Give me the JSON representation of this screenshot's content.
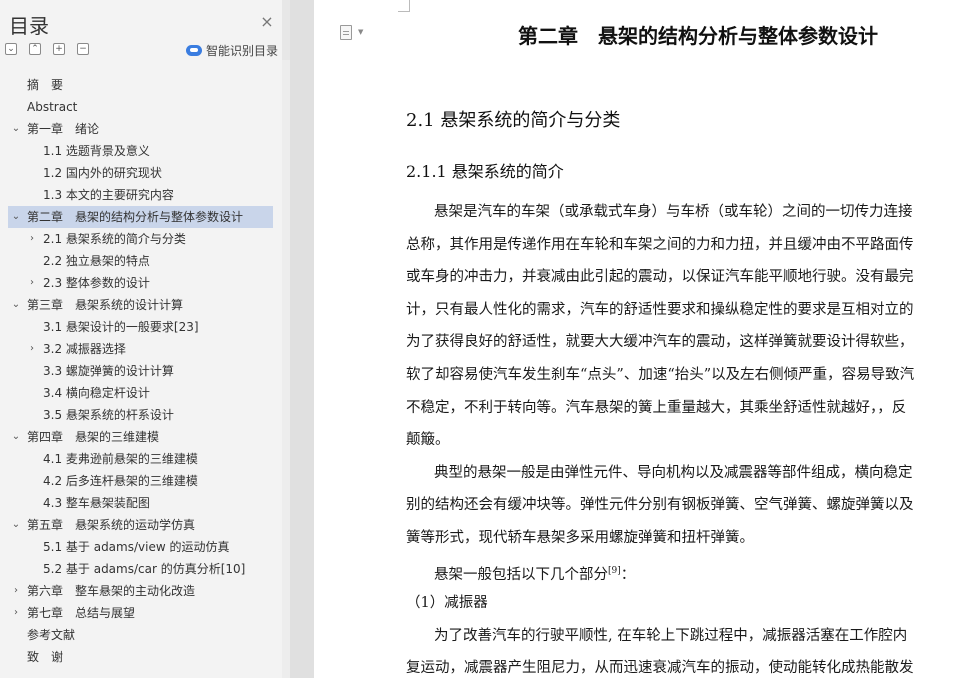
{
  "sidebar": {
    "title": "目录",
    "close_icon": "×",
    "tool_icons": [
      "collapse-icon",
      "expand-icon",
      "add-icon",
      "remove-icon"
    ],
    "tool_glyphs": [
      "⌄",
      "⌃",
      "+",
      "−"
    ],
    "smart_toc_label": "智能识别目录",
    "items": [
      {
        "label": "摘　要",
        "level": 0,
        "arrow": ""
      },
      {
        "label": "Abstract",
        "level": 0,
        "arrow": ""
      },
      {
        "label": "第一章　绪论",
        "level": 0,
        "arrow": "⌄"
      },
      {
        "label": "1.1 选题背景及意义",
        "level": 1,
        "arrow": ""
      },
      {
        "label": "1.2 国内外的研究现状",
        "level": 1,
        "arrow": ""
      },
      {
        "label": "1.3 本文的主要研究内容",
        "level": 1,
        "arrow": ""
      },
      {
        "label": "第二章　悬架的结构分析与整体参数设计",
        "level": 0,
        "arrow": "⌄",
        "selected": true
      },
      {
        "label": "2.1 悬架系统的简介与分类",
        "level": 1,
        "arrow": "›"
      },
      {
        "label": "2.2 独立悬架的特点",
        "level": 1,
        "arrow": ""
      },
      {
        "label": "2.3 整体参数的设计",
        "level": 1,
        "arrow": "›"
      },
      {
        "label": "第三章　悬架系统的设计计算",
        "level": 0,
        "arrow": "⌄"
      },
      {
        "label": "3.1 悬架设计的一般要求[23]",
        "level": 1,
        "arrow": ""
      },
      {
        "label": "3.2 减振器选择",
        "level": 1,
        "arrow": "›"
      },
      {
        "label": "3.3 螺旋弹簧的设计计算",
        "level": 1,
        "arrow": ""
      },
      {
        "label": "3.4 横向稳定杆设计",
        "level": 1,
        "arrow": ""
      },
      {
        "label": "3.5 悬架系统的杆系设计",
        "level": 1,
        "arrow": ""
      },
      {
        "label": "第四章　悬架的三维建模",
        "level": 0,
        "arrow": "⌄"
      },
      {
        "label": "4.1 麦弗逊前悬架的三维建模",
        "level": 1,
        "arrow": ""
      },
      {
        "label": "4.2 后多连杆悬架的三维建模",
        "level": 1,
        "arrow": ""
      },
      {
        "label": "4.3 整车悬架装配图",
        "level": 1,
        "arrow": ""
      },
      {
        "label": "第五章　悬架系统的运动学仿真",
        "level": 0,
        "arrow": "⌄"
      },
      {
        "label": "5.1 基于 adams/view 的运动仿真",
        "level": 1,
        "arrow": ""
      },
      {
        "label": "5.2 基于 adams/car 的仿真分析[10]",
        "level": 1,
        "arrow": ""
      },
      {
        "label": "第六章　整车悬架的主动化改造",
        "level": 0,
        "arrow": "›"
      },
      {
        "label": "第七章　总结与展望",
        "level": 0,
        "arrow": "›"
      },
      {
        "label": "参考文献",
        "level": 0,
        "arrow": ""
      },
      {
        "label": "致　谢",
        "level": 0,
        "arrow": ""
      }
    ]
  },
  "document": {
    "chapter_title": "第二章　悬架的结构分析与整体参数设计",
    "section_title": "2.1 悬架系统的简介与分类",
    "subsection_title": "2.1.1 悬架系统的简介",
    "lines": [
      {
        "text": "悬架是汽车的车架（或承载式车身）与车桥（或车轮）之间的一切传力连接",
        "indent": true
      },
      {
        "text": "总称，其作用是传递作用在车轮和车架之间的力和力扭，并且缓冲由不平路面传",
        "indent": false
      },
      {
        "text": "或车身的冲击力，并衰减由此引起的震动，以保证汽车能平顺地行驶。没有最完",
        "indent": false
      },
      {
        "text": "计，只有最人性化的需求，汽车的舒适性要求和操纵稳定性的要求是互相对立的",
        "indent": false
      },
      {
        "text": "为了获得良好的舒适性，就要大大缓冲汽车的震动，这样弹簧就要设计得软些，",
        "indent": false
      },
      {
        "text": "软了却容易使汽车发生刹车“点头”、加速“抬头”以及左右侧倾严重，容易导致汽",
        "indent": false
      },
      {
        "text": "不稳定，不利于转向等。汽车悬架的簧上重量越大，其乘坐舒适性就越好，，反",
        "indent": false
      },
      {
        "text": "颠簸。",
        "indent": false
      },
      {
        "text": "典型的悬架一般是由弹性元件、导向机构以及减震器等部件组成，横向稳定",
        "indent": true
      },
      {
        "text": "别的结构还会有缓冲块等。弹性元件分别有钢板弹簧、空气弹簧、螺旋弹簧以及",
        "indent": false
      },
      {
        "text": "簧等形式，现代轿车悬架多采用螺旋弹簧和扭杆弹簧。",
        "indent": false
      },
      {
        "text": "悬架一般包括以下几个部分",
        "indent": true,
        "sup": "[9]",
        "tail": "："
      },
      {
        "text": "（1）减振器",
        "indent": false,
        "outdent": true
      },
      {
        "text": "为了改善汽车的行驶平顺性, 在车轮上下跳过程中，减振器活塞在工作腔内",
        "indent": true
      },
      {
        "text": "复运动，减震器产生阻尼力，从而迅速衰减汽车的振动，使动能转化成热能散发",
        "indent": false
      }
    ]
  }
}
